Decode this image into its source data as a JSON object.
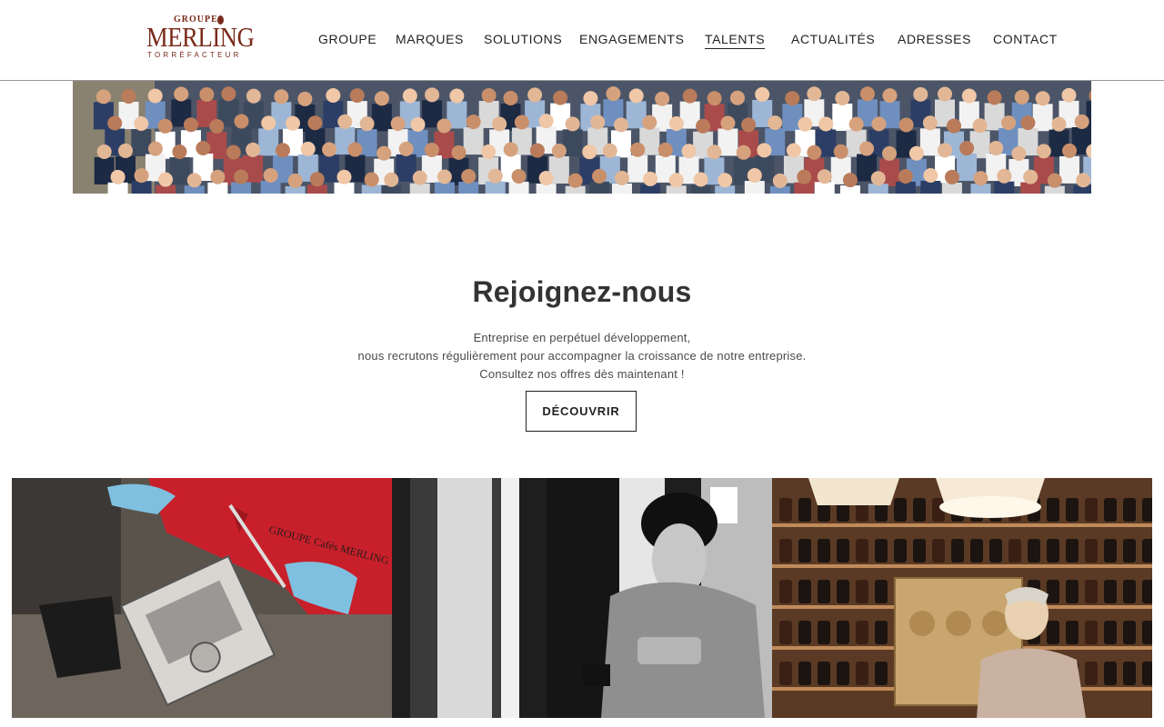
{
  "logo": {
    "top_text": "GROUPE",
    "main_text": "MERLING",
    "sub_text": "TORRÉFACTEUR"
  },
  "nav": {
    "items": [
      {
        "label": "GROUPE"
      },
      {
        "label": "MARQUES"
      },
      {
        "label": "SOLUTIONS"
      },
      {
        "label": "ENGAGEMENTS"
      },
      {
        "label": "TALENTS",
        "active": true
      },
      {
        "label": "ACTUALITÉS"
      },
      {
        "label": "ADRESSES"
      },
      {
        "label": "CONTACT"
      }
    ]
  },
  "join": {
    "title": "Rejoignez-nous",
    "lines": [
      "Entreprise en perpétuel développement,",
      "nous recrutons régulièrement pour accompagner la croissance de notre entreprise.",
      "Consultez nos offres dès maintenant !"
    ],
    "button_label": "DÉCOUVRIR"
  },
  "photos": {
    "photo1_shirt_text": "GROUPE Cafés MERLING"
  },
  "colors": {
    "brand": "#7a2a1a",
    "text": "#2b2b2b",
    "border": "#222222"
  }
}
